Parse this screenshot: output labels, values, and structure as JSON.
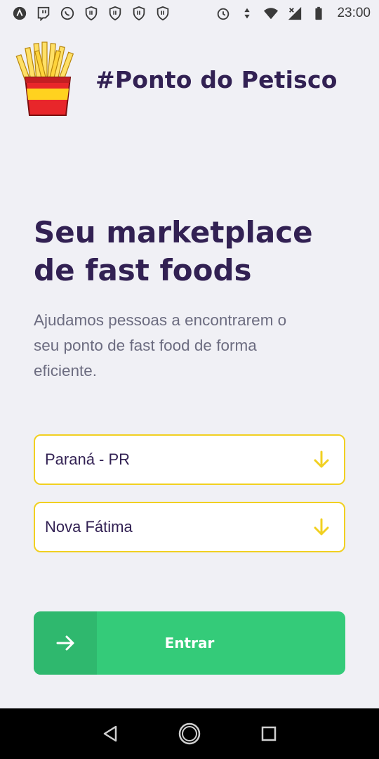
{
  "status_bar": {
    "left_icons": [
      "app-icon",
      "twitch-icon",
      "whatsapp-icon",
      "shield-hand-icon",
      "shield-hand-icon",
      "shield-hand-icon",
      "shield-hand-icon"
    ],
    "right_icons": [
      "alarm-icon",
      "data-arrows-icon",
      "wifi-icon",
      "signal-icon",
      "battery-icon"
    ],
    "time": "23:00"
  },
  "header": {
    "app_title": "#Ponto do Petisco",
    "logo_icon": "fries-icon"
  },
  "hero": {
    "title_line1": "Seu marketplace",
    "title_line2": "de fast foods",
    "description": "Ajudamos pessoas a encontrarem o seu ponto de fast food de forma eficiente."
  },
  "form": {
    "uf_select_value": "Paraná - PR",
    "city_select_value": "Nova Fátima",
    "arrow_icon": "arrow-down-icon"
  },
  "button": {
    "label": "Entrar",
    "icon": "arrow-right-icon"
  },
  "nav_bar": {
    "icons": [
      "back-icon",
      "home-icon",
      "recents-icon"
    ]
  },
  "colors": {
    "background": "#f0f0f5",
    "title": "#322153",
    "text": "#6c6c80",
    "accent_yellow": "#f1d021",
    "button_green": "#34cb79",
    "button_green_dark": "#2fb86e"
  }
}
